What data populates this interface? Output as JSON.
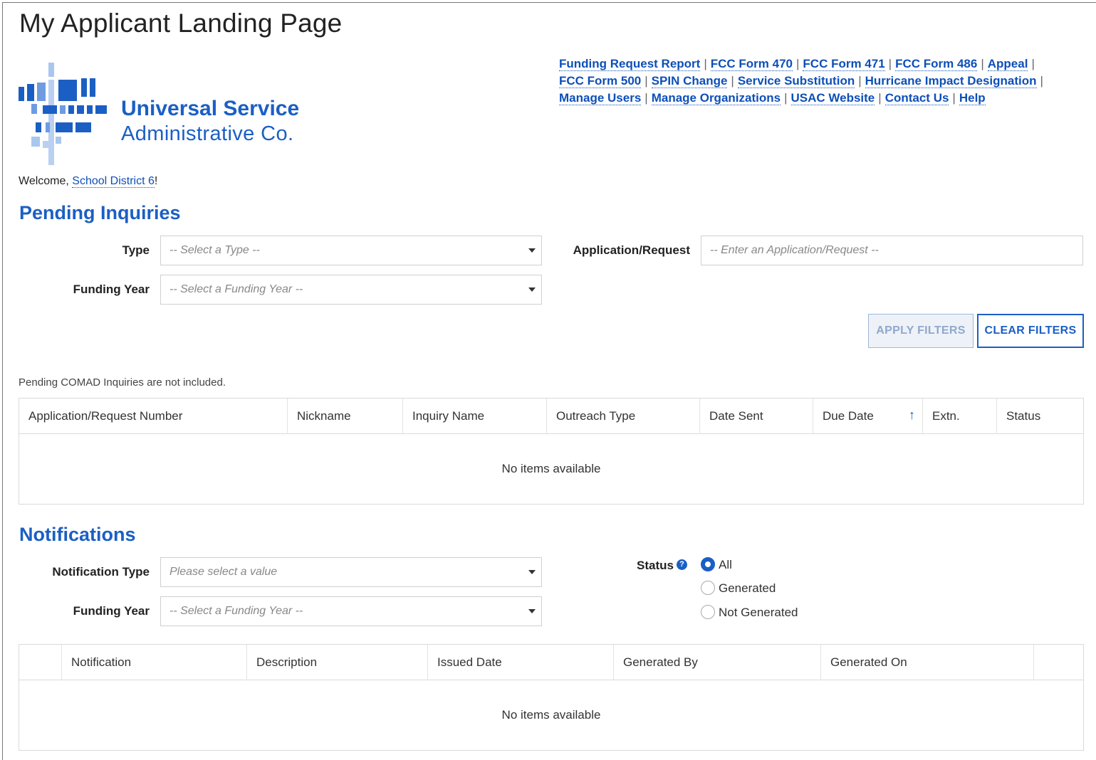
{
  "page": {
    "title": "My Applicant Landing Page"
  },
  "logo": {
    "line1": "Universal Service",
    "line2": "Administrative Co.",
    "color": "#1b5fc4"
  },
  "nav": {
    "links": [
      "Funding Request Report",
      "FCC Form 470",
      "FCC Form 471",
      "FCC Form 486",
      "Appeal",
      "FCC Form 500",
      "SPIN Change",
      "Service Substitution",
      "Hurricane Impact Designation",
      "Manage Users",
      "Manage Organizations",
      "USAC Website",
      "Contact Us",
      "Help"
    ],
    "separator": "|"
  },
  "welcome": {
    "prefix": "Welcome, ",
    "user": "School District 6",
    "suffix": "!"
  },
  "pending": {
    "heading": "Pending Inquiries",
    "type_label": "Type",
    "type_placeholder": "-- Select a Type --",
    "app_label": "Application/Request",
    "app_placeholder": "-- Enter an Application/Request --",
    "fy_label": "Funding Year",
    "fy_placeholder": "-- Select a Funding Year --",
    "apply_btn": "APPLY FILTERS",
    "clear_btn": "CLEAR FILTERS",
    "note": "Pending COMAD Inquiries are not included.",
    "columns": [
      "Application/Request Number",
      "Nickname",
      "Inquiry Name",
      "Outreach Type",
      "Date Sent",
      "Due Date",
      "Extn.",
      "Status"
    ],
    "sort_indicator": "↑",
    "empty": "No items available"
  },
  "notifications": {
    "heading": "Notifications",
    "type_label": "Notification Type",
    "type_placeholder": "Please select a value",
    "fy_label": "Funding Year",
    "fy_placeholder": "-- Select a Funding Year --",
    "status_label": "Status",
    "status_options": [
      "All",
      "Generated",
      "Not Generated"
    ],
    "status_selected": "All",
    "columns": [
      "Notification",
      "Description",
      "Issued Date",
      "Generated By",
      "Generated On"
    ],
    "empty": "No items available"
  }
}
